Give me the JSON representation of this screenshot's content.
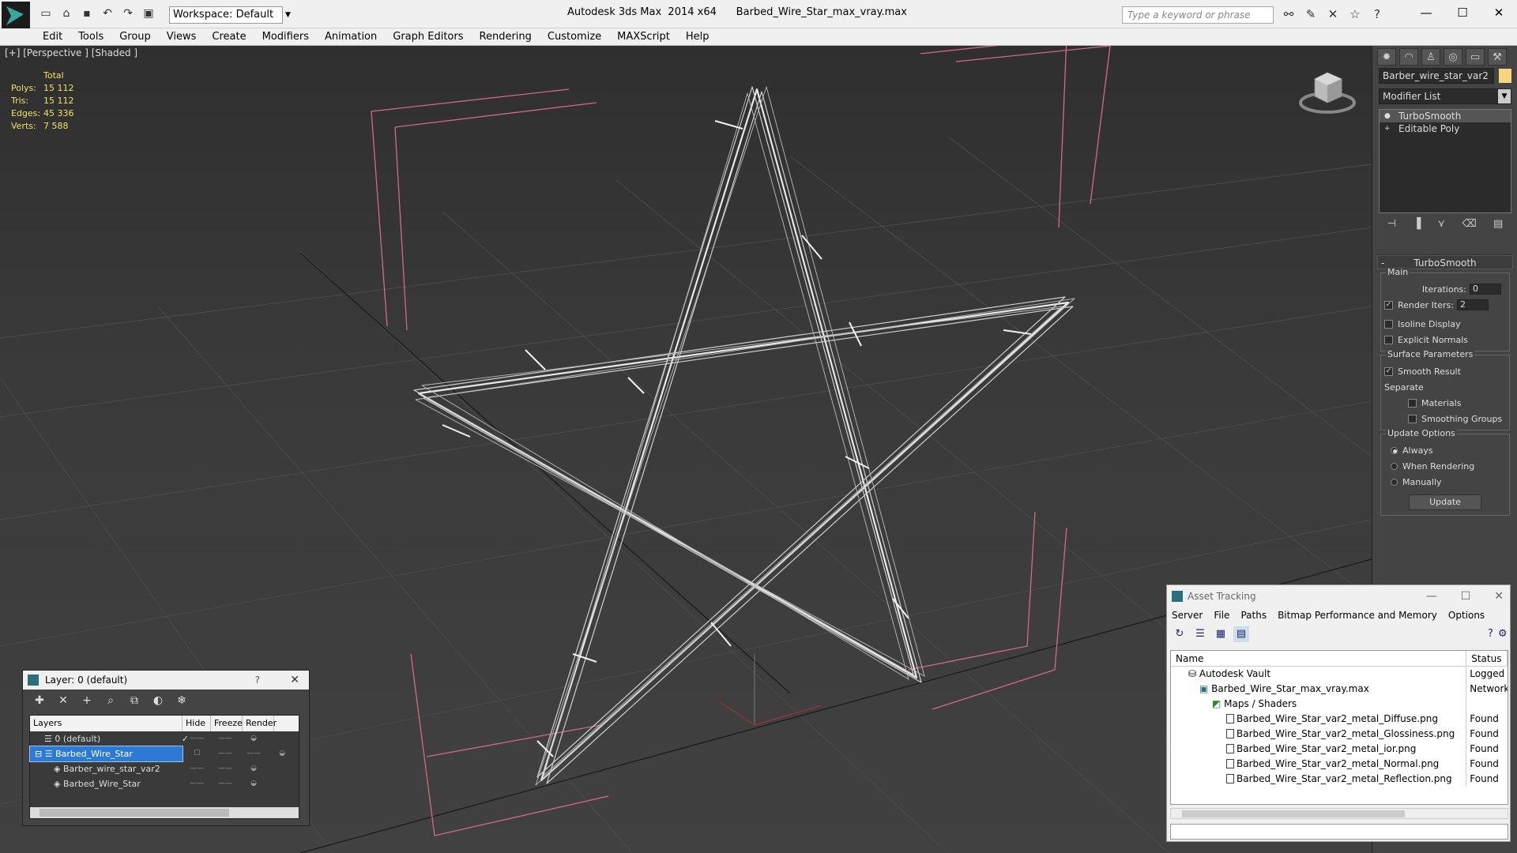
{
  "titlebar": {
    "workspace": "Workspace: Default",
    "title": "Autodesk 3ds Max  2014 x64      Barbed_Wire_Star_max_vray.max",
    "search_placeholder": "Type a keyword or phrase"
  },
  "menu": [
    "Edit",
    "Tools",
    "Group",
    "Views",
    "Create",
    "Modifiers",
    "Animation",
    "Graph Editors",
    "Rendering",
    "Customize",
    "MAXScript",
    "Help"
  ],
  "viewport": {
    "label": "[+] [Perspective ] [Shaded ]",
    "stats": {
      "header": "Total",
      "rows": [
        {
          "k": "Polys:",
          "v": "15 112"
        },
        {
          "k": "Tris:",
          "v": "15 112"
        },
        {
          "k": "Edges:",
          "v": "45 336"
        },
        {
          "k": "Verts:",
          "v": "7 588"
        }
      ]
    }
  },
  "command_panel": {
    "object_name": "Barber_wire_star_var2",
    "modifier_list": "Modifier List",
    "stack": [
      "TurboSmooth",
      "Editable Poly"
    ],
    "rollout_title": "TurboSmooth",
    "main": {
      "label": "Main",
      "iterations_label": "Iterations:",
      "iterations": "0",
      "render_iters_label": "Render Iters:",
      "render_iters": "2",
      "isoline": "Isoline Display",
      "explicit": "Explicit Normals"
    },
    "surface": {
      "label": "Surface Parameters",
      "smooth": "Smooth Result",
      "separate": "Separate",
      "materials": "Materials",
      "smoothing_groups": "Smoothing Groups"
    },
    "update": {
      "label": "Update Options",
      "always": "Always",
      "when_rendering": "When Rendering",
      "manually": "Manually",
      "button": "Update"
    }
  },
  "layer_dialog": {
    "title": "Layer: 0 (default)",
    "columns": [
      "Layers",
      "Hide",
      "Freeze",
      "Render"
    ],
    "rows": [
      "0 (default)",
      "Barbed_Wire_Star",
      "Barber_wire_star_var2",
      "Barbed_Wire_Star"
    ]
  },
  "asset_dialog": {
    "title": "Asset Tracking",
    "menu": [
      "Server",
      "File",
      "Paths",
      "Bitmap Performance and Memory",
      "Options"
    ],
    "columns": [
      "Name",
      "Status"
    ],
    "rows": [
      {
        "name": "Autodesk Vault",
        "status": "Logged C"
      },
      {
        "name": "Barbed_Wire_Star_max_vray.max",
        "status": "Network"
      },
      {
        "name": "Maps / Shaders",
        "status": ""
      },
      {
        "name": "Barbed_Wire_Star_var2_metal_Diffuse.png",
        "status": "Found"
      },
      {
        "name": "Barbed_Wire_Star_var2_metal_Glossiness.png",
        "status": "Found"
      },
      {
        "name": "Barbed_Wire_Star_var2_metal_ior.png",
        "status": "Found"
      },
      {
        "name": "Barbed_Wire_Star_var2_metal_Normal.png",
        "status": "Found"
      },
      {
        "name": "Barbed_Wire_Star_var2_metal_Reflection.png",
        "status": "Found"
      }
    ]
  }
}
